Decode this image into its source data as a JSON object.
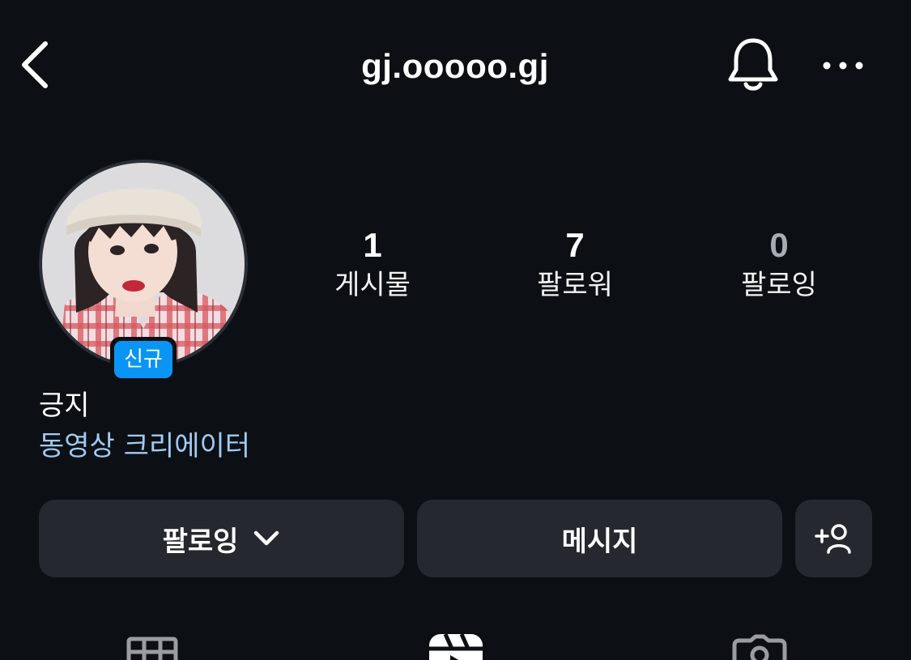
{
  "header": {
    "username": "gj.ooooo.gj",
    "back_icon": "chevron-left-icon",
    "bell_icon": "bell-icon",
    "more_icon": "more-horizontal-icon"
  },
  "profile": {
    "new_badge": "신규",
    "display_name": "긍지",
    "category": "동영상 크리에이터"
  },
  "stats": {
    "posts": {
      "count": "1",
      "label": "게시물"
    },
    "followers": {
      "count": "7",
      "label": "팔로워"
    },
    "following": {
      "count": "0",
      "label": "팔로잉"
    }
  },
  "actions": {
    "following_label": "팔로잉",
    "message_label": "메시지",
    "add_icon": "add-person-icon"
  },
  "tabs": {
    "grid_icon": "grid-icon",
    "reels_icon": "reels-icon",
    "tagged_icon": "tagged-icon"
  },
  "colors": {
    "background": "#0c0f14",
    "button": "#25282e",
    "badge": "#0a95f5",
    "category_text": "#a0cbf2"
  }
}
